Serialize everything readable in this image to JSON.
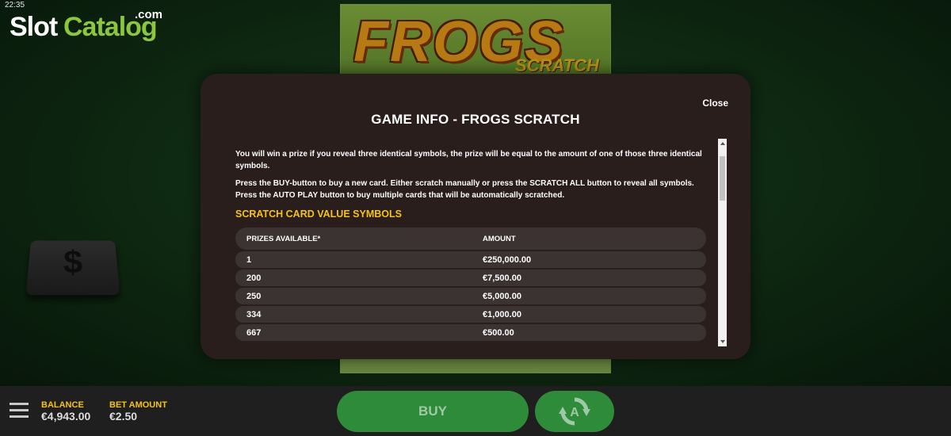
{
  "status_bar": {
    "time": "22:35"
  },
  "watermark": {
    "brand_part1": "Slot",
    "brand_part2": "Catalog",
    "domain": ".com"
  },
  "game": {
    "title": "FROGS",
    "subtitle": "SCRATCH",
    "tile_symbol": "$"
  },
  "modal": {
    "close_label": "Close",
    "title": "GAME INFO - FROGS SCRATCH",
    "paragraphs": [
      "You will win a prize if you reveal three identical symbols, the prize will be equal to the amount of one of those three identical symbols.",
      "Press the BUY-button to buy a new card. Either scratch manually or press the SCRATCH ALL button to reveal all symbols. Press the AUTO PLAY button to buy multiple cards that will be automatically scratched."
    ],
    "section_heading": "SCRATCH CARD VALUE SYMBOLS",
    "table": {
      "headers": [
        "PRIZES AVAILABLE*",
        "AMOUNT"
      ],
      "rows": [
        [
          "1",
          "€250,000.00"
        ],
        [
          "200",
          "€7,500.00"
        ],
        [
          "250",
          "€5,000.00"
        ],
        [
          "334",
          "€1,000.00"
        ],
        [
          "667",
          "€500.00"
        ]
      ]
    }
  },
  "bottom_bar": {
    "balance_label": "BALANCE",
    "balance_value": "€4,943.00",
    "bet_label": "BET AMOUNT",
    "bet_value": "€2.50",
    "buy_label": "BUY"
  },
  "colors": {
    "accent_yellow": "#f4c21b",
    "button_green": "#2e8b3a",
    "modal_bg": "#2a1e1c"
  }
}
